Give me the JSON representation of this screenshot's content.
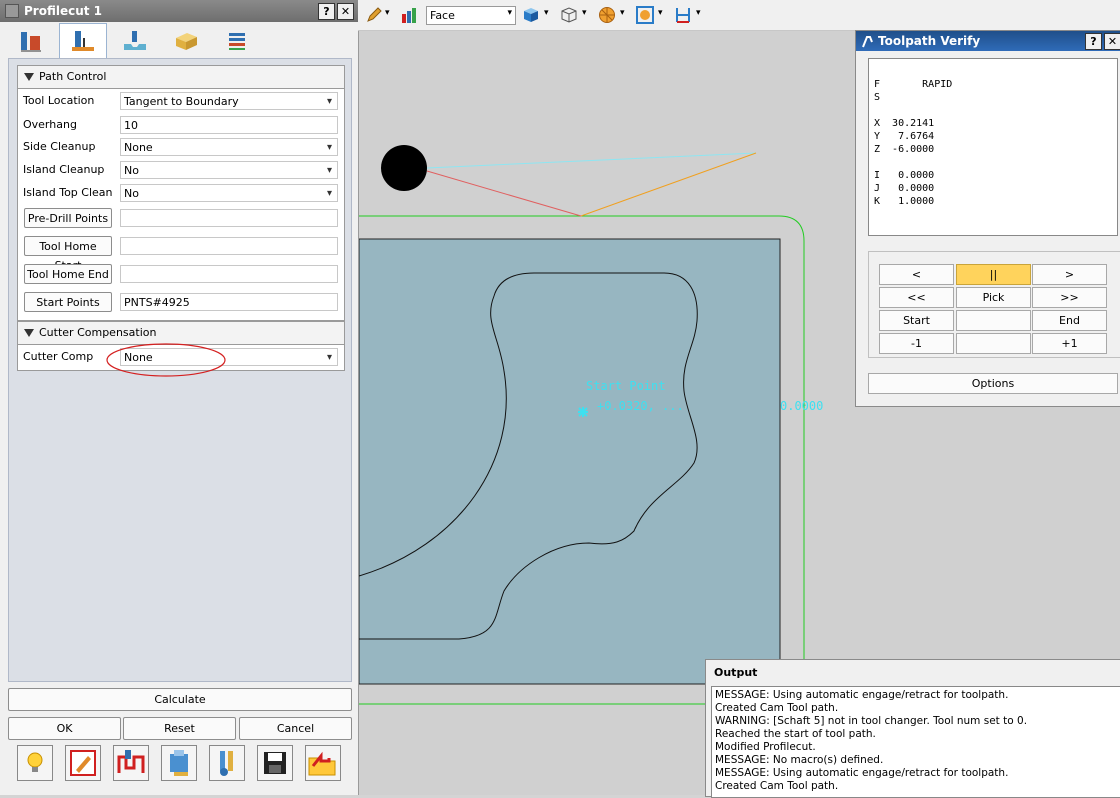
{
  "profile_panel": {
    "title": "Profilecut 1",
    "help_btn": "?",
    "close_btn": "✕",
    "tabs": [
      {
        "icon": "tool-holder-icon"
      },
      {
        "icon": "path-control-icon",
        "active": true
      },
      {
        "icon": "depth-icon"
      },
      {
        "icon": "stock-block-icon"
      },
      {
        "icon": "layers-icon"
      }
    ],
    "path_control": {
      "header": "Path Control",
      "tool_location_label": "Tool Location",
      "tool_location_value": "Tangent to Boundary",
      "overhang_label": "Overhang",
      "overhang_value": "10",
      "side_cleanup_label": "Side Cleanup",
      "side_cleanup_value": "None",
      "island_cleanup_label": "Island Cleanup",
      "island_cleanup_value": "No",
      "island_top_clean_label": "Island Top Clean",
      "island_top_clean_value": "No",
      "pre_drill_label": "Pre-Drill Points",
      "pre_drill_value": "",
      "tool_home_start_label": "Tool Home Start",
      "tool_home_start_value": "",
      "tool_home_end_label": "Tool Home End",
      "tool_home_end_value": "",
      "start_points_label": "Start Points",
      "start_points_value": "PNTS#4925"
    },
    "cutter_comp": {
      "header": "Cutter Compensation",
      "label": "Cutter Comp",
      "value": "None"
    },
    "calculate_label": "Calculate",
    "ok_label": "OK",
    "reset_label": "Reset",
    "cancel_label": "Cancel",
    "bottom_icons": [
      "lightbulb-icon",
      "edit-sheet-icon",
      "profile-path-icon",
      "tool-database-icon",
      "tool-settings-icon",
      "save-icon",
      "open-folder-icon"
    ]
  },
  "toolbar": {
    "view_select": "Face"
  },
  "viewport": {
    "start_point_label": "Start Point",
    "coord_label_1": "+0.0320, ...",
    "coord_label_2": "0.0000",
    "colors": {
      "background": "#d0d0d0",
      "stock": "#97b6c1",
      "boundary": "#22cc22",
      "rapid_cyan": "#8ee6f2",
      "rapid_red": "#e06060",
      "rapid_orange": "#f0a020",
      "text_cyan": "#3ee0f0"
    }
  },
  "toolpath_verify": {
    "title": "Toolpath Verify",
    "help_btn": "?",
    "close_btn": "✕",
    "f_line": "F       RAPID",
    "s_line": "S",
    "x_line": "X  30.2141",
    "y_line": "Y   7.6764",
    "z_line": "Z  -6.0000",
    "i_line": "I   0.0000",
    "j_line": "J   0.0000",
    "k_line": "K   1.0000",
    "buttons": {
      "prev": "<",
      "pause": "||",
      "next": ">",
      "rewind": "<<",
      "pick": "Pick",
      "fastforward": ">>",
      "start": "Start",
      "blank1": "",
      "end": "End",
      "minus_one": "-1",
      "blank2": "",
      "plus_one": "+1"
    },
    "options_label": "Options"
  },
  "output": {
    "title": "Output",
    "lines": [
      "MESSAGE: Using automatic engage/retract for toolpath.",
      "Created Cam Tool path.",
      "WARNING: [Schaft 5] not in tool changer. Tool num set to 0.",
      "Reached the start of tool path.",
      "Modified Profilecut.",
      "MESSAGE: No macro(s) defined.",
      "MESSAGE: Using automatic engage/retract for toolpath.",
      "Created Cam Tool path."
    ]
  }
}
